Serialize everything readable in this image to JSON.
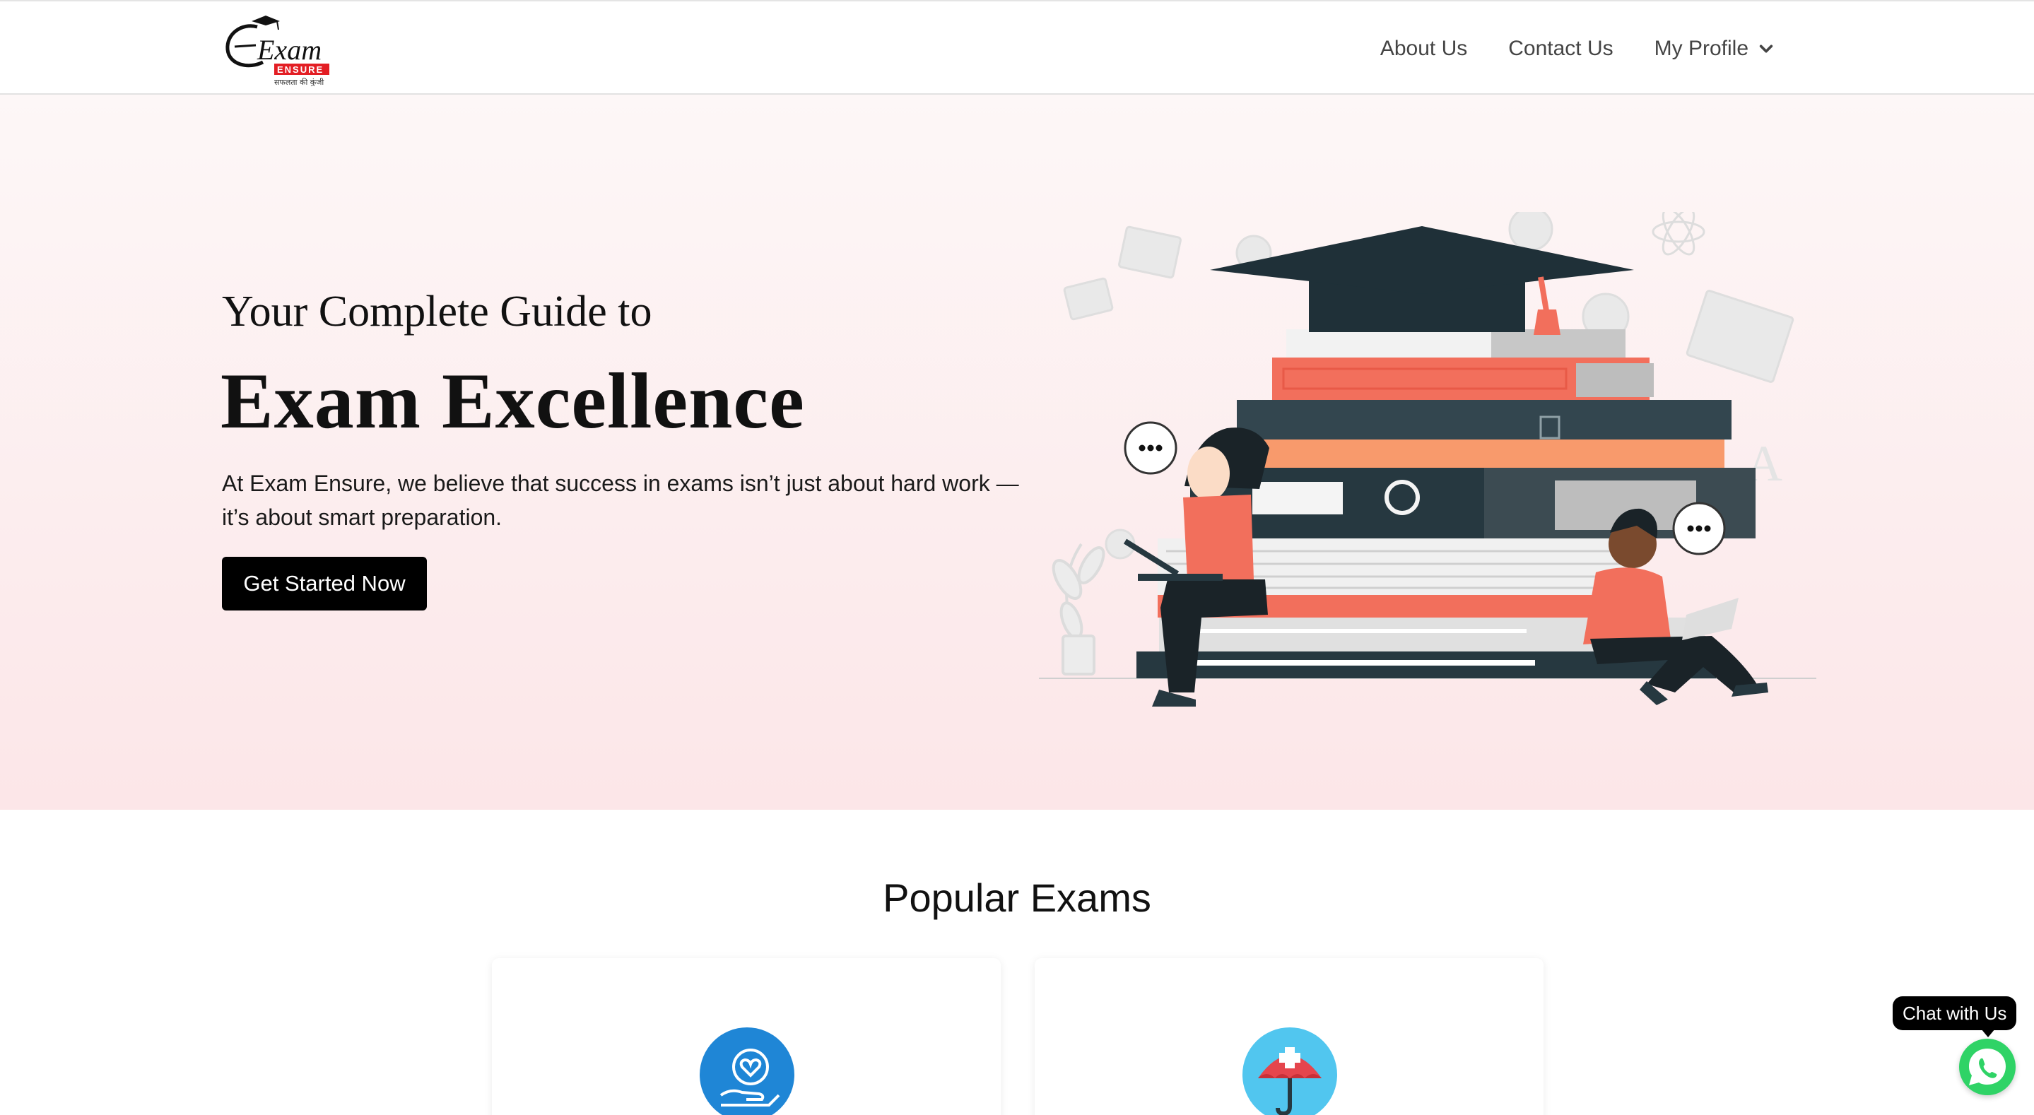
{
  "brand": {
    "logo_text": "Exam",
    "logo_badge": "ENSURE",
    "logo_tagline": "सफलता की कुंजी"
  },
  "nav": {
    "items": [
      {
        "label": "About Us"
      },
      {
        "label": "Contact Us"
      },
      {
        "label": "My Profile"
      }
    ]
  },
  "hero": {
    "subtitle": "Your Complete Guide to",
    "title": "Exam Excellence",
    "description": "At Exam Ensure, we believe that success in exams isn’t just about hard work — it’s about smart preparation.",
    "cta_label": "Get Started Now"
  },
  "popular": {
    "title": "Popular Exams",
    "cards": [
      {
        "icon": "heart-hand-icon"
      },
      {
        "icon": "umbrella-icon"
      }
    ]
  },
  "chat": {
    "label": "Chat with Us",
    "icon": "whatsapp-icon"
  },
  "colors": {
    "accent": "#f26f5c",
    "dark": "#263840",
    "cta": "#000000",
    "whatsapp": "#2fd366"
  }
}
